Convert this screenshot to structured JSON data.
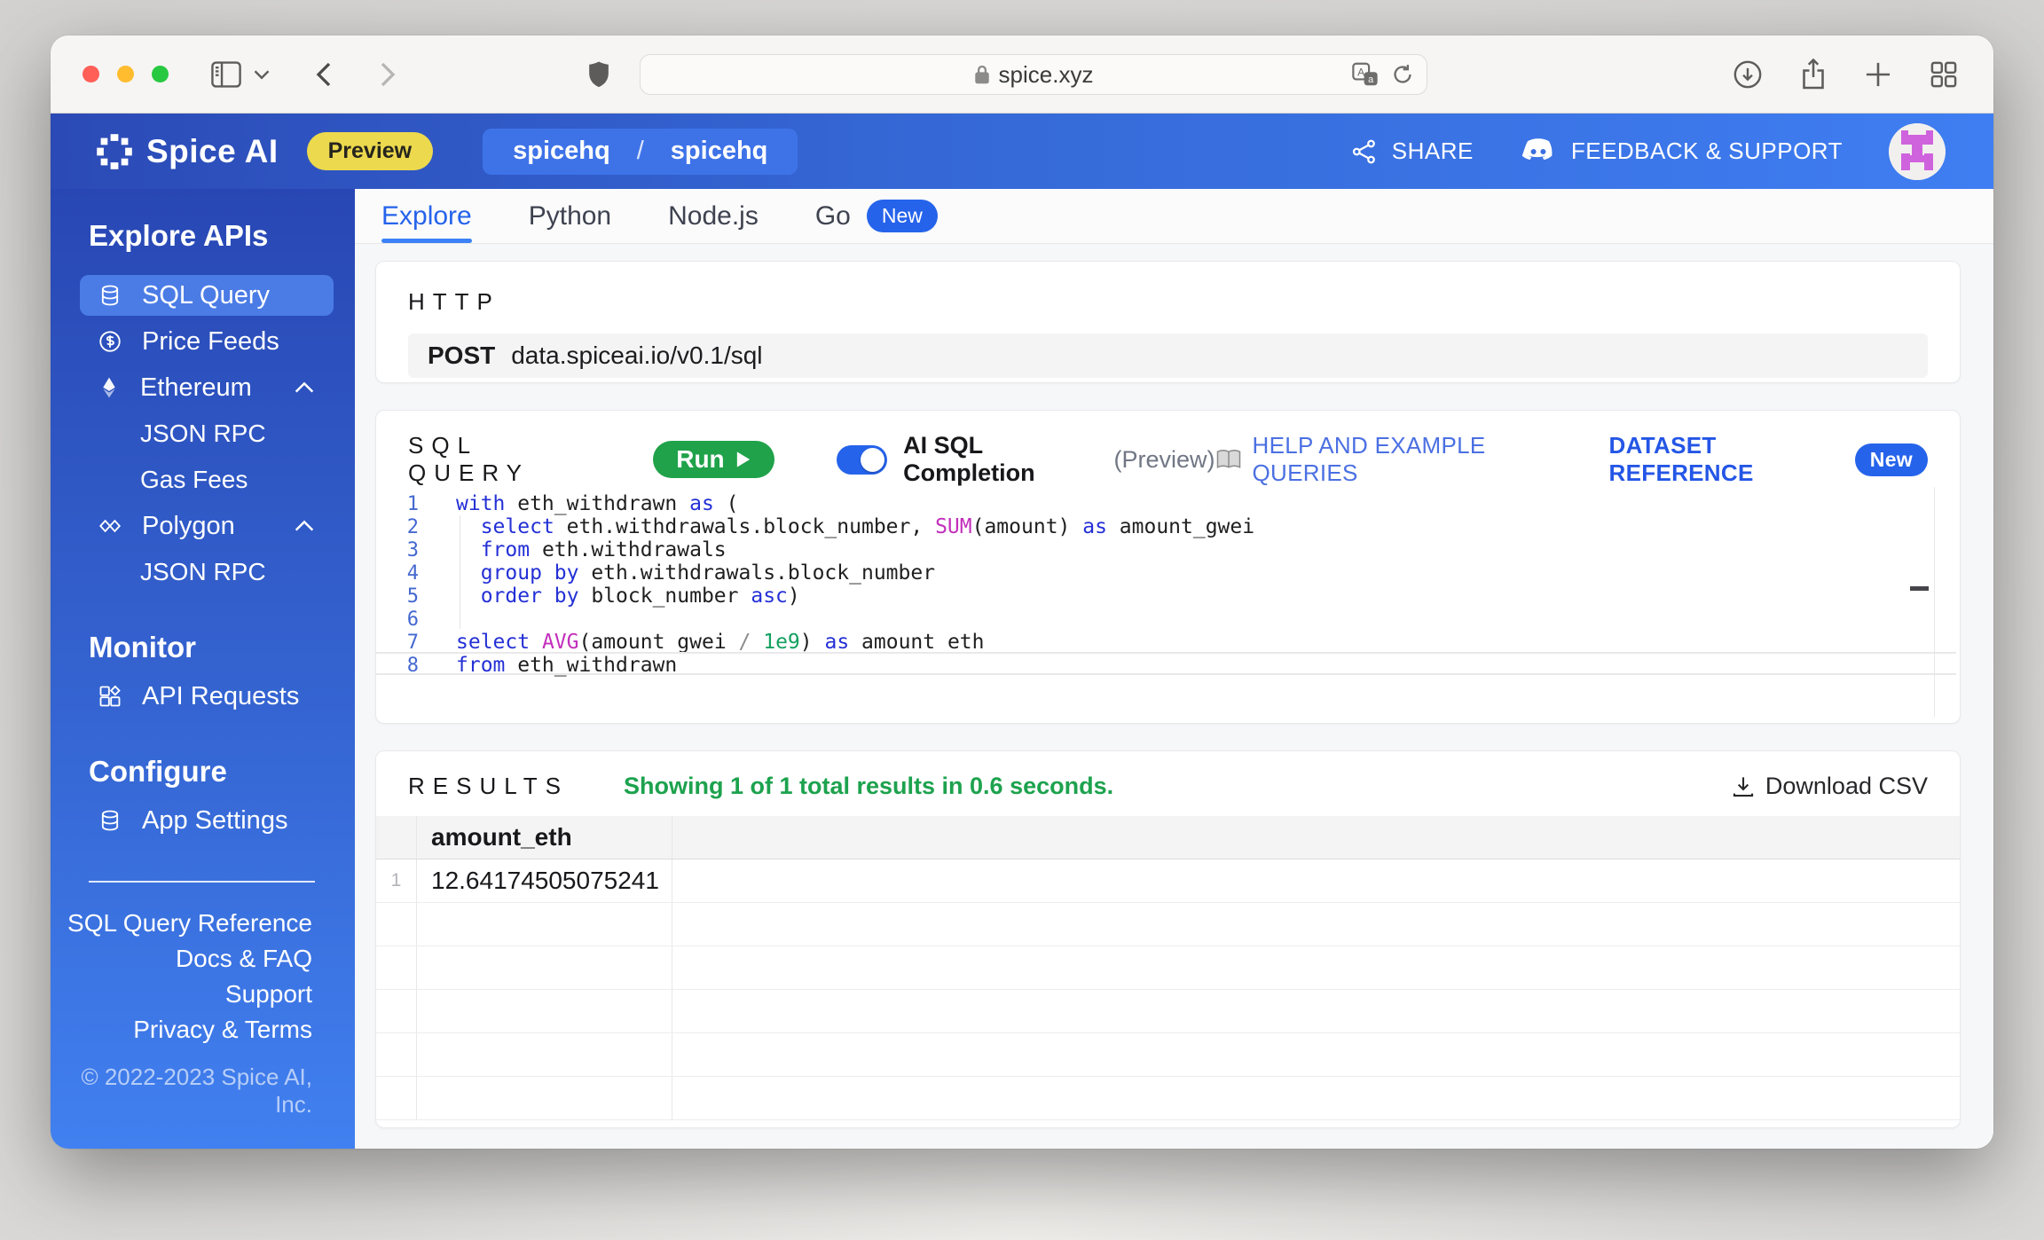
{
  "browser": {
    "url": "spice.xyz"
  },
  "header": {
    "brand": "Spice AI",
    "preview_badge": "Preview",
    "org": "spicehq",
    "slash": "/",
    "app": "spicehq",
    "share": "SHARE",
    "feedback": "FEEDBACK & SUPPORT"
  },
  "sidebar": {
    "explore_heading": "Explore APIs",
    "items": {
      "sql_query": "SQL Query",
      "price_feeds": "Price Feeds",
      "ethereum": "Ethereum",
      "json_rpc_eth": "JSON RPC",
      "gas_fees": "Gas Fees",
      "polygon": "Polygon",
      "json_rpc_poly": "JSON RPC"
    },
    "monitor_heading": "Monitor",
    "api_requests": "API Requests",
    "configure_heading": "Configure",
    "app_settings": "App Settings",
    "links": {
      "sql_ref": "SQL Query Reference",
      "docs": "Docs & FAQ",
      "support": "Support",
      "privacy": "Privacy & Terms"
    },
    "copyright": "© 2022-2023 Spice AI, Inc."
  },
  "tabs": {
    "explore": "Explore",
    "python": "Python",
    "nodejs": "Node.js",
    "go": "Go",
    "go_badge": "New"
  },
  "http": {
    "label": "HTTP",
    "method": "POST",
    "endpoint": "data.spiceai.io/v0.1/sql"
  },
  "sql": {
    "label": "SQL QUERY",
    "run": "Run",
    "ai_label": "AI SQL Completion",
    "ai_preview": "(Preview)",
    "help": "HELP AND EXAMPLE QUERIES",
    "dataset_ref": "DATASET REFERENCE",
    "dataset_badge": "New",
    "code": [
      {
        "n": "1",
        "t": [
          "with",
          " eth_withdrawn ",
          "as",
          " ("
        ]
      },
      {
        "n": "2",
        "t": [
          "  ",
          "select",
          " eth.withdrawals.block_number, ",
          "SUM",
          "(amount) ",
          "as",
          " amount_gwei"
        ]
      },
      {
        "n": "3",
        "t": [
          "  ",
          "from",
          " eth.withdrawals"
        ]
      },
      {
        "n": "4",
        "t": [
          "  ",
          "group by",
          " eth.withdrawals.block_number"
        ]
      },
      {
        "n": "5",
        "t": [
          "  ",
          "order by",
          " block_number ",
          "asc",
          ")"
        ]
      },
      {
        "n": "6",
        "t": [
          ""
        ]
      },
      {
        "n": "7",
        "t": [
          "select",
          " ",
          "AVG",
          "(amount_gwei ",
          "/",
          " ",
          "1e9",
          ") ",
          "as",
          " amount_eth"
        ]
      },
      {
        "n": "8",
        "t": [
          "from",
          " eth_withdrawn"
        ]
      }
    ]
  },
  "results": {
    "label": "RESULTS",
    "status": "Showing 1 of 1 total results in 0.6 seconds.",
    "download": "Download CSV",
    "columns": [
      "amount_eth"
    ],
    "rows": [
      {
        "num": "1",
        "amount_eth": "12.64174505075241"
      }
    ]
  },
  "colors": {
    "accent_blue": "#2563eb",
    "header_blue_left": "#2b4ab6",
    "header_blue_right": "#3f7ef2",
    "sidebar_selected": "#4b7ce6",
    "preview_yellow": "#ecd94e",
    "run_green": "#1fa24a",
    "status_green": "#1da24e",
    "keyword_blue": "#2430d6",
    "function_magenta": "#c32fbc",
    "number_green": "#13a060",
    "avatar_magenta": "#cf63de"
  }
}
